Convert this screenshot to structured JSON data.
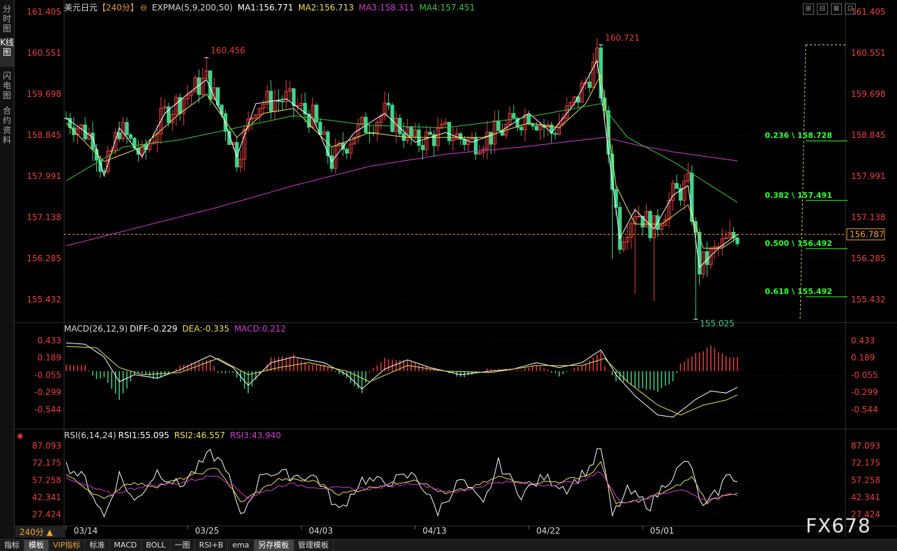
{
  "sidebar": {
    "items": [
      {
        "label": "分时图",
        "active": false
      },
      {
        "label": "K线图",
        "active": true
      },
      {
        "label": "闪电图",
        "active": false
      },
      {
        "label": "合约资料",
        "active": false
      }
    ]
  },
  "window_buttons": [
    "⊞",
    "⊟",
    "⊠",
    "⊡"
  ],
  "main_header": {
    "symbol": "美元日元",
    "period_tag": "【240分】",
    "indicator": "EXPMA(5,9,200,50)",
    "ma1": "MA1:156.771",
    "ma2": "MA2:156.713",
    "ma3": "MA3:158.311",
    "ma4": "MA4:157.451"
  },
  "macd_header": {
    "name": "MACD(26,12,9)",
    "diff": "DIFF:-0.229",
    "dea": "DEA:-0.335",
    "macd": "MACD:0.212"
  },
  "rsi_header": {
    "name": "RSI(6,14,24)",
    "rsi1": "RSI1:55.095",
    "rsi2": "RSI2:46.557",
    "rsi3": "RSI3:43.940"
  },
  "period_selector": "240分 ▲",
  "watermark": "FX678",
  "bottom_tabs": [
    {
      "label": "指标",
      "state": ""
    },
    {
      "label": "模板",
      "state": "on"
    },
    {
      "label": "VIP指标",
      "state": "vip"
    },
    {
      "label": "标准",
      "state": ""
    },
    {
      "label": "MACD",
      "state": ""
    },
    {
      "label": "BOLL",
      "state": ""
    },
    {
      "label": "一图",
      "state": ""
    },
    {
      "label": "RSI+B",
      "state": ""
    },
    {
      "label": "ema",
      "state": ""
    },
    {
      "label": "另存模板",
      "state": "on"
    },
    {
      "label": "管理模板",
      "state": ""
    }
  ],
  "colors": {
    "up": "#e84040",
    "down": "#3fd28a",
    "ma1": "#ffffff",
    "ma2": "#e8e05a",
    "ma3": "#d23cd2",
    "ma4": "#3cc83c",
    "fib": "#33ff33",
    "axis": "#e84040",
    "price_line": "#e8a33b"
  },
  "chart_data": [
    {
      "type": "candlestick",
      "title": "美元日元 240分",
      "y_ticks": [
        "161.405",
        "160.551",
        "159.698",
        "158.845",
        "157.991",
        "157.138",
        "156.285",
        "155.432"
      ],
      "ylim": [
        155.0,
        161.45
      ],
      "x_ticks": [
        "03/14",
        "03/25",
        "04/03",
        "04/13",
        "04/22",
        "05/01"
      ],
      "last_price": "156.787",
      "annotations": [
        {
          "label": "160.456",
          "type": "high"
        },
        {
          "label": "160.721",
          "type": "high"
        },
        {
          "label": "155.025",
          "type": "low"
        }
      ],
      "fibonacci": [
        {
          "label": "0.236",
          "value": "158.728"
        },
        {
          "label": "0.382",
          "value": "157.491"
        },
        {
          "label": "0.500",
          "value": "156.492"
        },
        {
          "label": "0.618",
          "value": "155.492"
        }
      ],
      "series": [
        {
          "name": "MA1",
          "anchors": [
            [
              0,
              159.2
            ],
            [
              7,
              158.8
            ],
            [
              10,
              158.0
            ],
            [
              14,
              159.0
            ],
            [
              20,
              158.4
            ],
            [
              26,
              159.3
            ],
            [
              32,
              159.7
            ],
            [
              37,
              160.0
            ],
            [
              41,
              159.3
            ],
            [
              45,
              158.4
            ],
            [
              50,
              159.5
            ],
            [
              58,
              159.6
            ],
            [
              65,
              159.2
            ],
            [
              70,
              158.3
            ],
            [
              76,
              158.9
            ],
            [
              84,
              159.3
            ],
            [
              92,
              158.7
            ],
            [
              100,
              158.9
            ],
            [
              107,
              158.7
            ],
            [
              114,
              158.9
            ],
            [
              122,
              159.3
            ],
            [
              128,
              158.9
            ],
            [
              134,
              159.5
            ],
            [
              140,
              160.4
            ],
            [
              143,
              158.5
            ],
            [
              146,
              156.7
            ],
            [
              150,
              157.3
            ],
            [
              155,
              156.9
            ],
            [
              160,
              157.6
            ],
            [
              164,
              157.8
            ],
            [
              167,
              156.1
            ],
            [
              172,
              156.5
            ],
            [
              177,
              156.787
            ]
          ]
        },
        {
          "name": "MA2",
          "anchors": [
            [
              0,
              159.1
            ],
            [
              10,
              158.3
            ],
            [
              20,
              158.6
            ],
            [
              30,
              159.3
            ],
            [
              37,
              159.7
            ],
            [
              45,
              158.8
            ],
            [
              52,
              159.3
            ],
            [
              60,
              159.4
            ],
            [
              70,
              158.6
            ],
            [
              80,
              158.9
            ],
            [
              90,
              158.8
            ],
            [
              100,
              158.8
            ],
            [
              110,
              158.8
            ],
            [
              122,
              159.1
            ],
            [
              130,
              159.0
            ],
            [
              137,
              159.5
            ],
            [
              141,
              160.1
            ],
            [
              145,
              157.8
            ],
            [
              150,
              157.0
            ],
            [
              157,
              157.0
            ],
            [
              164,
              157.4
            ],
            [
              168,
              156.5
            ],
            [
              173,
              156.5
            ],
            [
              177,
              156.713
            ]
          ]
        },
        {
          "name": "MA3",
          "anchors": [
            [
              0,
              156.55
            ],
            [
              20,
              156.95
            ],
            [
              40,
              157.35
            ],
            [
              60,
              157.8
            ],
            [
              80,
              158.2
            ],
            [
              100,
              158.45
            ],
            [
              120,
              158.6
            ],
            [
              142,
              158.8
            ],
            [
              150,
              158.65
            ],
            [
              160,
              158.5
            ],
            [
              177,
              158.311
            ]
          ]
        },
        {
          "name": "MA4",
          "anchors": [
            [
              0,
              157.9
            ],
            [
              15,
              158.6
            ],
            [
              30,
              158.75
            ],
            [
              45,
              159.0
            ],
            [
              60,
              159.25
            ],
            [
              80,
              159.05
            ],
            [
              100,
              159.0
            ],
            [
              120,
              159.2
            ],
            [
              141,
              159.5
            ],
            [
              148,
              158.8
            ],
            [
              160,
              158.3
            ],
            [
              170,
              157.8
            ],
            [
              177,
              157.451
            ]
          ]
        }
      ]
    },
    {
      "type": "macd",
      "title": "MACD(26,12,9)",
      "y_ticks": [
        "0.433",
        "0.189",
        "-0.055",
        "-0.299",
        "-0.544"
      ],
      "ylim": [
        -0.78,
        0.52
      ],
      "series": [
        {
          "name": "DIFF",
          "anchors": [
            [
              0,
              0.4
            ],
            [
              5,
              0.38
            ],
            [
              10,
              0.2
            ],
            [
              14,
              -0.15
            ],
            [
              18,
              -0.05
            ],
            [
              24,
              -0.1
            ],
            [
              30,
              0.02
            ],
            [
              38,
              0.22
            ],
            [
              44,
              0.05
            ],
            [
              48,
              -0.2
            ],
            [
              54,
              0.12
            ],
            [
              60,
              0.2
            ],
            [
              68,
              0.12
            ],
            [
              74,
              -0.05
            ],
            [
              78,
              -0.25
            ],
            [
              84,
              0.03
            ],
            [
              90,
              0.16
            ],
            [
              96,
              0.05
            ],
            [
              104,
              -0.05
            ],
            [
              112,
              0.0
            ],
            [
              118,
              0.03
            ],
            [
              124,
              0.12
            ],
            [
              130,
              0.05
            ],
            [
              136,
              0.12
            ],
            [
              141,
              0.3
            ],
            [
              145,
              -0.05
            ],
            [
              150,
              -0.35
            ],
            [
              156,
              -0.62
            ],
            [
              160,
              -0.65
            ],
            [
              166,
              -0.4
            ],
            [
              170,
              -0.28
            ],
            [
              174,
              -0.31
            ],
            [
              177,
              -0.229
            ]
          ]
        },
        {
          "name": "DEA",
          "anchors": [
            [
              0,
              0.35
            ],
            [
              8,
              0.33
            ],
            [
              14,
              0.05
            ],
            [
              20,
              -0.05
            ],
            [
              30,
              -0.02
            ],
            [
              40,
              0.18
            ],
            [
              48,
              -0.05
            ],
            [
              56,
              0.05
            ],
            [
              64,
              0.12
            ],
            [
              74,
              0.0
            ],
            [
              80,
              -0.15
            ],
            [
              90,
              0.08
            ],
            [
              100,
              0.0
            ],
            [
              112,
              -0.02
            ],
            [
              124,
              0.08
            ],
            [
              136,
              0.08
            ],
            [
              142,
              0.18
            ],
            [
              148,
              -0.15
            ],
            [
              156,
              -0.48
            ],
            [
              162,
              -0.62
            ],
            [
              168,
              -0.48
            ],
            [
              174,
              -0.41
            ],
            [
              177,
              -0.335
            ]
          ]
        }
      ]
    },
    {
      "type": "rsi",
      "title": "RSI(6,14,24)",
      "y_ticks": [
        "87.093",
        "72.175",
        "57.258",
        "42.341",
        "27.424"
      ],
      "ylim": [
        18,
        92
      ],
      "series": [
        {
          "name": "RSI1",
          "anchors": [
            [
              0,
              70
            ],
            [
              5,
              58
            ],
            [
              10,
              25
            ],
            [
              14,
              62
            ],
            [
              18,
              38
            ],
            [
              24,
              65
            ],
            [
              30,
              52
            ],
            [
              38,
              80
            ],
            [
              42,
              70
            ],
            [
              46,
              24
            ],
            [
              52,
              65
            ],
            [
              58,
              62
            ],
            [
              66,
              60
            ],
            [
              72,
              30
            ],
            [
              78,
              58
            ],
            [
              84,
              55
            ],
            [
              92,
              62
            ],
            [
              98,
              30
            ],
            [
              104,
              58
            ],
            [
              110,
              35
            ],
            [
              114,
              72
            ],
            [
              120,
              45
            ],
            [
              126,
              60
            ],
            [
              132,
              50
            ],
            [
              138,
              68
            ],
            [
              141,
              86
            ],
            [
              144,
              26
            ],
            [
              148,
              48
            ],
            [
              154,
              35
            ],
            [
              158,
              55
            ],
            [
              164,
              75
            ],
            [
              168,
              32
            ],
            [
              172,
              48
            ],
            [
              175,
              65
            ],
            [
              177,
              55.095
            ]
          ]
        },
        {
          "name": "RSI2",
          "anchors": [
            [
              0,
              62
            ],
            [
              10,
              40
            ],
            [
              16,
              55
            ],
            [
              24,
              52
            ],
            [
              30,
              58
            ],
            [
              40,
              68
            ],
            [
              46,
              38
            ],
            [
              56,
              58
            ],
            [
              66,
              56
            ],
            [
              72,
              45
            ],
            [
              82,
              52
            ],
            [
              92,
              58
            ],
            [
              100,
              45
            ],
            [
              108,
              52
            ],
            [
              114,
              60
            ],
            [
              122,
              55
            ],
            [
              130,
              56
            ],
            [
              138,
              62
            ],
            [
              141,
              72
            ],
            [
              145,
              36
            ],
            [
              152,
              40
            ],
            [
              160,
              50
            ],
            [
              165,
              60
            ],
            [
              169,
              38
            ],
            [
              174,
              45
            ],
            [
              177,
              46.557
            ]
          ]
        },
        {
          "name": "RSI3",
          "anchors": [
            [
              0,
              58
            ],
            [
              12,
              45
            ],
            [
              20,
              52
            ],
            [
              30,
              55
            ],
            [
              40,
              62
            ],
            [
              48,
              42
            ],
            [
              58,
              54
            ],
            [
              70,
              50
            ],
            [
              80,
              50
            ],
            [
              92,
              55
            ],
            [
              102,
              46
            ],
            [
              114,
              56
            ],
            [
              126,
              53
            ],
            [
              136,
              56
            ],
            [
              141,
              65
            ],
            [
              146,
              38
            ],
            [
              154,
              42
            ],
            [
              162,
              50
            ],
            [
              168,
              40
            ],
            [
              174,
              44
            ],
            [
              177,
              43.94
            ]
          ]
        }
      ]
    }
  ]
}
